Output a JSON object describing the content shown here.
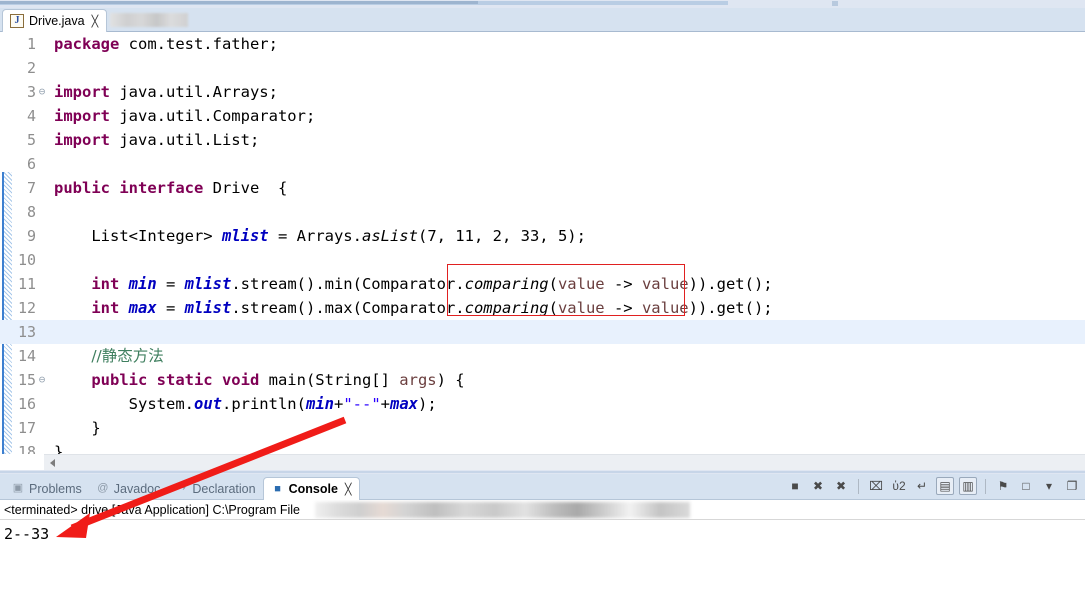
{
  "window": {
    "app": "Eclipse IDE",
    "accent_red": "#e02020",
    "keyword_color": "#7f0055",
    "field_color": "#0000c0",
    "comment_color": "#3f7f5f",
    "string_color": "#2a00ff"
  },
  "editor_tab": {
    "label": "Drive.java",
    "icon": "java-file-icon",
    "icon_letter": "J",
    "close": "╳"
  },
  "code": {
    "lines": [
      {
        "n": "1",
        "fold": "",
        "current": false,
        "tokens": [
          {
            "t": "package ",
            "c": "kw"
          },
          {
            "t": "com.test.father;",
            "c": "plain"
          }
        ]
      },
      {
        "n": "2",
        "fold": "",
        "current": false,
        "tokens": []
      },
      {
        "n": "3",
        "fold": "⊖",
        "current": false,
        "tokens": [
          {
            "t": "import ",
            "c": "kw"
          },
          {
            "t": "java.util.Arrays;",
            "c": "plain"
          }
        ]
      },
      {
        "n": "4",
        "fold": "",
        "current": false,
        "tokens": [
          {
            "t": "import ",
            "c": "kw"
          },
          {
            "t": "java.util.Comparator;",
            "c": "plain"
          }
        ]
      },
      {
        "n": "5",
        "fold": "",
        "current": false,
        "tokens": [
          {
            "t": "import ",
            "c": "kw"
          },
          {
            "t": "java.util.List;",
            "c": "plain"
          }
        ]
      },
      {
        "n": "6",
        "fold": "",
        "current": false,
        "tokens": []
      },
      {
        "n": "7",
        "fold": "",
        "current": false,
        "tokens": [
          {
            "t": "public interface ",
            "c": "kw"
          },
          {
            "t": "Drive",
            "c": "plain"
          },
          {
            "t": "  {",
            "c": "plain"
          }
        ]
      },
      {
        "n": "8",
        "fold": "",
        "current": false,
        "tokens": []
      },
      {
        "n": "9",
        "fold": "",
        "current": false,
        "tokens": [
          {
            "t": "    List<Integer> ",
            "c": "plain"
          },
          {
            "t": "mlist",
            "c": "fld"
          },
          {
            "t": " = Arrays.",
            "c": "plain"
          },
          {
            "t": "asList",
            "c": "mth"
          },
          {
            "t": "(7, 11, 2, 33, 5);",
            "c": "plain"
          }
        ]
      },
      {
        "n": "10",
        "fold": "",
        "current": false,
        "tokens": []
      },
      {
        "n": "11",
        "fold": "",
        "current": false,
        "tokens": [
          {
            "t": "    ",
            "c": "plain"
          },
          {
            "t": "int ",
            "c": "kw"
          },
          {
            "t": "min",
            "c": "fld"
          },
          {
            "t": " = ",
            "c": "plain"
          },
          {
            "t": "mlist",
            "c": "fld"
          },
          {
            "t": ".stream().min(Comparator.",
            "c": "plain"
          },
          {
            "t": "comparing",
            "c": "mth"
          },
          {
            "t": "(",
            "c": "plain"
          },
          {
            "t": "value",
            "c": "par"
          },
          {
            "t": " -> ",
            "c": "plain"
          },
          {
            "t": "value",
            "c": "par"
          },
          {
            "t": ")).get();",
            "c": "plain"
          }
        ]
      },
      {
        "n": "12",
        "fold": "",
        "current": false,
        "tokens": [
          {
            "t": "    ",
            "c": "plain"
          },
          {
            "t": "int ",
            "c": "kw"
          },
          {
            "t": "max",
            "c": "fld"
          },
          {
            "t": " = ",
            "c": "plain"
          },
          {
            "t": "mlist",
            "c": "fld"
          },
          {
            "t": ".stream().max(Comparator.",
            "c": "plain"
          },
          {
            "t": "comparing",
            "c": "mth"
          },
          {
            "t": "(",
            "c": "plain"
          },
          {
            "t": "value",
            "c": "par"
          },
          {
            "t": " -> ",
            "c": "plain"
          },
          {
            "t": "value",
            "c": "par"
          },
          {
            "t": ")).get();",
            "c": "plain"
          }
        ]
      },
      {
        "n": "13",
        "fold": "",
        "current": true,
        "tokens": []
      },
      {
        "n": "14",
        "fold": "",
        "current": false,
        "tokens": [
          {
            "t": "    ",
            "c": "plain"
          },
          {
            "t": "//静态方法",
            "c": "cmt"
          }
        ]
      },
      {
        "n": "15",
        "fold": "⊖",
        "current": false,
        "tokens": [
          {
            "t": "    ",
            "c": "plain"
          },
          {
            "t": "public static void ",
            "c": "kw"
          },
          {
            "t": "main(String[] ",
            "c": "plain"
          },
          {
            "t": "args",
            "c": "par"
          },
          {
            "t": ") {",
            "c": "plain"
          }
        ]
      },
      {
        "n": "16",
        "fold": "",
        "current": false,
        "tokens": [
          {
            "t": "        System.",
            "c": "plain"
          },
          {
            "t": "out",
            "c": "fld"
          },
          {
            "t": ".println(",
            "c": "plain"
          },
          {
            "t": "min",
            "c": "fld"
          },
          {
            "t": "+",
            "c": "plain"
          },
          {
            "t": "\"--\"",
            "c": "str"
          },
          {
            "t": "+",
            "c": "plain"
          },
          {
            "t": "max",
            "c": "fld"
          },
          {
            "t": ");",
            "c": "plain"
          }
        ]
      },
      {
        "n": "17",
        "fold": "",
        "current": false,
        "tokens": [
          {
            "t": "    }",
            "c": "plain"
          }
        ]
      },
      {
        "n": "18",
        "fold": "",
        "current": false,
        "tokens": [
          {
            "t": "}",
            "c": "plain"
          }
        ]
      }
    ]
  },
  "annotations": {
    "highlight_box": {
      "label": "comparator-comparing-highlight",
      "color": "#e02020"
    },
    "arrow": {
      "label": "red-arrow-pointing-to-console",
      "color": "#f01c18"
    }
  },
  "console": {
    "tabs": [
      {
        "label": "Problems",
        "icon": "problems-icon",
        "glyph": "▣",
        "active": false
      },
      {
        "label": "Javadoc",
        "icon": "javadoc-icon",
        "glyph": "@",
        "active": false
      },
      {
        "label": "Declaration",
        "icon": "declaration-icon",
        "glyph": "↪",
        "active": false
      },
      {
        "label": "Console",
        "icon": "console-icon",
        "glyph": "■",
        "active": true
      }
    ],
    "close_glyph": "╳",
    "toolbar": [
      {
        "name": "terminate-icon",
        "glyph": "■",
        "boxed": false
      },
      {
        "name": "terminate-all-icon",
        "glyph": "✖",
        "boxed": false
      },
      {
        "name": "remove-all-terminated-icon",
        "glyph": "✖",
        "boxed": false
      },
      {
        "name": "separator",
        "glyph": "",
        "boxed": false
      },
      {
        "name": "clear-console-icon",
        "glyph": "⌧",
        "boxed": false
      },
      {
        "name": "scroll-lock-icon",
        "glyph": "ὑ2",
        "boxed": false
      },
      {
        "name": "word-wrap-icon",
        "glyph": "↵",
        "boxed": false
      },
      {
        "name": "show-console-on-output-icon",
        "glyph": "▤",
        "boxed": true
      },
      {
        "name": "show-console-on-error-icon",
        "glyph": "▥",
        "boxed": true
      },
      {
        "name": "separator2",
        "glyph": "",
        "boxed": false
      },
      {
        "name": "pin-console-icon",
        "glyph": "⚑",
        "boxed": false
      },
      {
        "name": "display-selected-console-icon",
        "glyph": "□",
        "boxed": false
      },
      {
        "name": "console-menu-dropdown-icon",
        "glyph": "▾",
        "boxed": false
      },
      {
        "name": "open-console-icon",
        "glyph": "❐",
        "boxed": false
      }
    ],
    "process_line": "<terminated> drive [Java Application] C:\\Program File",
    "output": "2--33"
  }
}
